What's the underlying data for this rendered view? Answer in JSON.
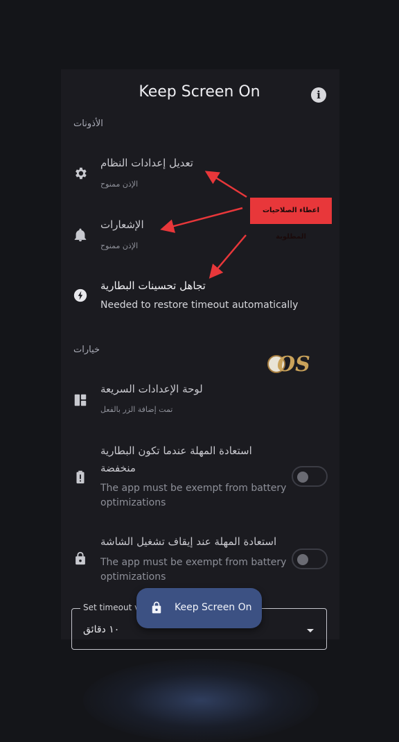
{
  "app": {
    "title": "Keep Screen On"
  },
  "sections": {
    "permissions_label": "الأذونات",
    "options_label": "خيارات"
  },
  "permissions": [
    {
      "title": "تعديل إعدادات النظام",
      "subtitle": "الإذن ممنوح",
      "icon": "gear-icon"
    },
    {
      "title": "الإشعارات",
      "subtitle": "الإذن ممنوح",
      "icon": "bell-icon"
    },
    {
      "title": "تجاهل تحسينات البطارية",
      "subtitle": "Needed to restore timeout automatically",
      "icon": "battery-leaf-icon"
    }
  ],
  "options": [
    {
      "title": "لوحة الإعدادات السريعة",
      "subtitle": "تمت إضافة الزر بالفعل",
      "icon": "dashboard-icon"
    },
    {
      "title_line1": "استعادة المهلة عندما تكون البطارية",
      "title_line2": "منخفضة",
      "subtitle_line1": "The app must be exempt from battery",
      "subtitle_line2": "optimizations",
      "icon": "battery-alert-icon",
      "toggle": false
    },
    {
      "title": "استعادة المهلة عند إيقاف تشغيل الشاشة",
      "subtitle_line1": "The app must be exempt from battery",
      "subtitle_line2": "optimizations",
      "icon": "lock-icon",
      "toggle": false
    }
  ],
  "timeout": {
    "label": "Set timeout v",
    "value": "١٠ دقائق"
  },
  "fab": {
    "label": "Keep Screen On",
    "icon": "lock-icon"
  },
  "annotation": {
    "text": "اعطاء الصلاحيات المطلوبة",
    "color": "#e8373a"
  },
  "watermark": {
    "text": "OS"
  },
  "colors": {
    "background": "#141519",
    "panel": "#1b1b20",
    "fab": "#3c5183",
    "callout": "#e8373a"
  }
}
